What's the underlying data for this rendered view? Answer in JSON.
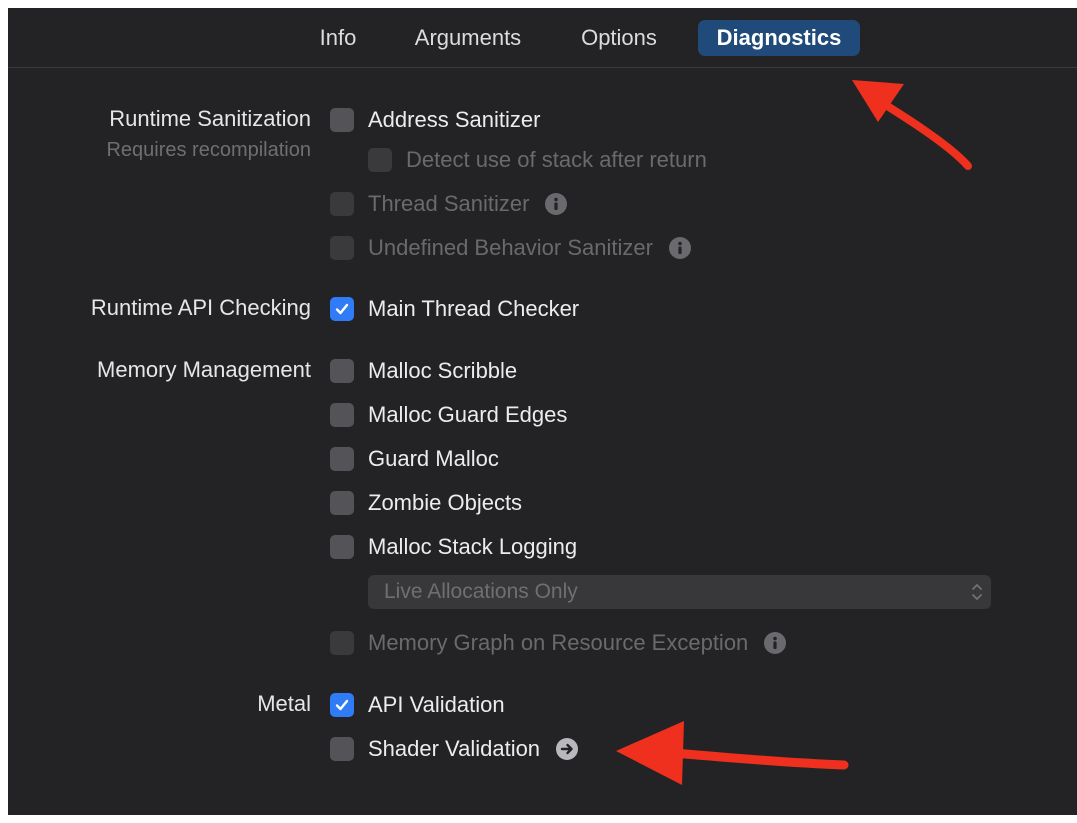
{
  "tabs": [
    {
      "label": "Info",
      "active": false
    },
    {
      "label": "Arguments",
      "active": false
    },
    {
      "label": "Options",
      "active": false
    },
    {
      "label": "Diagnostics",
      "active": true
    }
  ],
  "sections": {
    "runtime_sanitization": {
      "label": "Runtime Sanitization",
      "sublabel": "Requires recompilation",
      "options": {
        "address_sanitizer": {
          "label": "Address Sanitizer",
          "checked": false,
          "enabled": true
        },
        "detect_stack_after_return": {
          "label": "Detect use of stack after return",
          "checked": false,
          "enabled": false
        },
        "thread_sanitizer": {
          "label": "Thread Sanitizer",
          "checked": false,
          "enabled": false,
          "icon": "info-icon"
        },
        "undefined_behavior_sanitizer": {
          "label": "Undefined Behavior Sanitizer",
          "checked": false,
          "enabled": false,
          "icon": "info-icon"
        }
      }
    },
    "runtime_api_checking": {
      "label": "Runtime API Checking",
      "options": {
        "main_thread_checker": {
          "label": "Main Thread Checker",
          "checked": true,
          "enabled": true
        }
      }
    },
    "memory_management": {
      "label": "Memory Management",
      "options": {
        "malloc_scribble": {
          "label": "Malloc Scribble",
          "checked": false,
          "enabled": true
        },
        "malloc_guard_edges": {
          "label": "Malloc Guard Edges",
          "checked": false,
          "enabled": true
        },
        "guard_malloc": {
          "label": "Guard Malloc",
          "checked": false,
          "enabled": true
        },
        "zombie_objects": {
          "label": "Zombie Objects",
          "checked": false,
          "enabled": true
        },
        "malloc_stack_logging": {
          "label": "Malloc Stack Logging",
          "checked": false,
          "enabled": true
        },
        "memory_graph_resource_exception": {
          "label": "Memory Graph on Resource Exception",
          "checked": false,
          "enabled": false,
          "icon": "info-icon"
        }
      },
      "logging_mode": {
        "value": "Live Allocations Only",
        "enabled": false
      }
    },
    "metal": {
      "label": "Metal",
      "options": {
        "api_validation": {
          "label": "API Validation",
          "checked": true,
          "enabled": true
        },
        "shader_validation": {
          "label": "Shader Validation",
          "checked": false,
          "enabled": true,
          "icon": "arrow-circle-icon"
        }
      }
    }
  },
  "colors": {
    "background": "#232325",
    "tab_active": "#1f4a7a",
    "checkbox_checked": "#2f7cf6",
    "annotation_arrow": "#f0301e"
  }
}
